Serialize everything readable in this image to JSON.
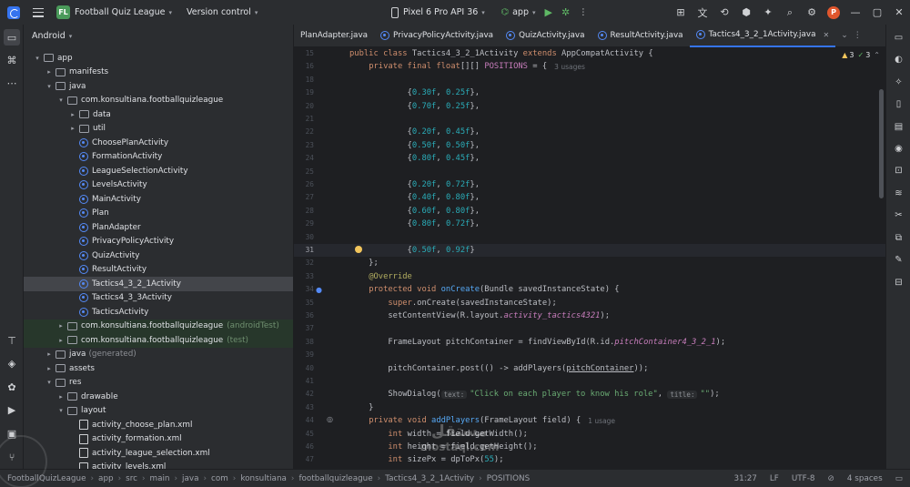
{
  "titlebar": {
    "project_initials": "FL",
    "project_name": "Football Quiz League",
    "version_control": "Version control",
    "device": "Pixel 6 Pro API 36",
    "run_config": "app",
    "avatar_initial": "P"
  },
  "project_panel": {
    "view": "Android",
    "tree": [
      {
        "label": "app",
        "indent": 0,
        "arrow": "open",
        "icon": "folder"
      },
      {
        "label": "manifests",
        "indent": 1,
        "arrow": "closed",
        "icon": "folder"
      },
      {
        "label": "java",
        "indent": 1,
        "arrow": "open",
        "icon": "folder"
      },
      {
        "label": "com.konsultiana.footballquizleague",
        "indent": 2,
        "arrow": "open",
        "icon": "package"
      },
      {
        "label": "data",
        "indent": 3,
        "arrow": "closed",
        "icon": "package"
      },
      {
        "label": "util",
        "indent": 3,
        "arrow": "closed",
        "icon": "package"
      },
      {
        "label": "ChoosePlanActivity",
        "indent": 3,
        "arrow": "",
        "icon": "class"
      },
      {
        "label": "FormationActivity",
        "indent": 3,
        "arrow": "",
        "icon": "class"
      },
      {
        "label": "LeagueSelectionActivity",
        "indent": 3,
        "arrow": "",
        "icon": "class"
      },
      {
        "label": "LevelsActivity",
        "indent": 3,
        "arrow": "",
        "icon": "class"
      },
      {
        "label": "MainActivity",
        "indent": 3,
        "arrow": "",
        "icon": "class"
      },
      {
        "label": "Plan",
        "indent": 3,
        "arrow": "",
        "icon": "class"
      },
      {
        "label": "PlanAdapter",
        "indent": 3,
        "arrow": "",
        "icon": "class"
      },
      {
        "label": "PrivacyPolicyActivity",
        "indent": 3,
        "arrow": "",
        "icon": "class"
      },
      {
        "label": "QuizActivity",
        "indent": 3,
        "arrow": "",
        "icon": "class"
      },
      {
        "label": "ResultActivity",
        "indent": 3,
        "arrow": "",
        "icon": "class"
      },
      {
        "label": "Tactics4_3_2_1Activity",
        "indent": 3,
        "arrow": "",
        "icon": "class",
        "selected": true
      },
      {
        "label": "Tactics4_3_3Activity",
        "indent": 3,
        "arrow": "",
        "icon": "class"
      },
      {
        "label": "TacticsActivity",
        "indent": 3,
        "arrow": "",
        "icon": "class"
      },
      {
        "label": "com.konsultiana.footballquizleague",
        "suffix": "(androidTest)",
        "indent": 2,
        "arrow": "closed",
        "icon": "package",
        "test": true
      },
      {
        "label": "com.konsultiana.footballquizleague",
        "suffix": "(test)",
        "indent": 2,
        "arrow": "closed",
        "icon": "package",
        "test": true
      },
      {
        "label": "java",
        "suffix": "(generated)",
        "indent": 1,
        "arrow": "closed",
        "icon": "folder"
      },
      {
        "label": "assets",
        "indent": 1,
        "arrow": "closed",
        "icon": "folder"
      },
      {
        "label": "res",
        "indent": 1,
        "arrow": "open",
        "icon": "folder"
      },
      {
        "label": "drawable",
        "indent": 2,
        "arrow": "closed",
        "icon": "folder"
      },
      {
        "label": "layout",
        "indent": 2,
        "arrow": "open",
        "icon": "folder"
      },
      {
        "label": "activity_choose_plan.xml",
        "indent": 3,
        "arrow": "",
        "icon": "xml"
      },
      {
        "label": "activity_formation.xml",
        "indent": 3,
        "arrow": "",
        "icon": "xml"
      },
      {
        "label": "activity_league_selection.xml",
        "indent": 3,
        "arrow": "",
        "icon": "xml"
      },
      {
        "label": "activity_levels.xml",
        "indent": 3,
        "arrow": "",
        "icon": "xml"
      }
    ]
  },
  "tabs": [
    {
      "label": "PlanAdapter.java",
      "active": false
    },
    {
      "label": "PrivacyPolicyActivity.java",
      "active": false
    },
    {
      "label": "QuizActivity.java",
      "active": false
    },
    {
      "label": "ResultActivity.java",
      "active": false
    },
    {
      "label": "Tactics4_3_2_1Activity.java",
      "active": true
    }
  ],
  "inspections": {
    "warnings": "3",
    "weak_warnings": "3"
  },
  "editor": {
    "line_numbers": [
      "15",
      "16",
      "18",
      "19",
      "20",
      "21",
      "22",
      "23",
      "24",
      "25",
      "26",
      "27",
      "28",
      "29",
      "30",
      "31",
      "32",
      "33",
      "34",
      "35",
      "36",
      "37",
      "38",
      "39",
      "40",
      "41",
      "42",
      "43",
      "44",
      "45",
      "46",
      "47"
    ],
    "lines": [
      [
        {
          "t": "public class ",
          "c": "kw"
        },
        {
          "t": "Tactics4_3_2_1Activity "
        },
        {
          "t": "extends ",
          "c": "kw"
        },
        {
          "t": "AppCompatActivity {"
        }
      ],
      [
        {
          "t": "    "
        },
        {
          "t": "private final float",
          "c": "kw"
        },
        {
          "t": "[][] "
        },
        {
          "t": "POSITIONS",
          "c": "fld"
        },
        {
          "t": " = {"
        },
        {
          "t": "3 usages",
          "c": "usage"
        }
      ],
      [],
      [
        {
          "t": "            {"
        },
        {
          "t": "0.30f",
          "c": "num"
        },
        {
          "t": ", "
        },
        {
          "t": "0.25f",
          "c": "num"
        },
        {
          "t": "},"
        }
      ],
      [
        {
          "t": "            {"
        },
        {
          "t": "0.70f",
          "c": "num"
        },
        {
          "t": ", "
        },
        {
          "t": "0.25f",
          "c": "num"
        },
        {
          "t": "},"
        }
      ],
      [],
      [
        {
          "t": "            {"
        },
        {
          "t": "0.20f",
          "c": "num"
        },
        {
          "t": ", "
        },
        {
          "t": "0.45f",
          "c": "num"
        },
        {
          "t": "},"
        }
      ],
      [
        {
          "t": "            {"
        },
        {
          "t": "0.50f",
          "c": "num"
        },
        {
          "t": ", "
        },
        {
          "t": "0.50f",
          "c": "num"
        },
        {
          "t": "},"
        }
      ],
      [
        {
          "t": "            {"
        },
        {
          "t": "0.80f",
          "c": "num"
        },
        {
          "t": ", "
        },
        {
          "t": "0.45f",
          "c": "num"
        },
        {
          "t": "},"
        }
      ],
      [],
      [
        {
          "t": "            {"
        },
        {
          "t": "0.20f",
          "c": "num"
        },
        {
          "t": ", "
        },
        {
          "t": "0.72f",
          "c": "num"
        },
        {
          "t": "},"
        }
      ],
      [
        {
          "t": "            {"
        },
        {
          "t": "0.40f",
          "c": "num"
        },
        {
          "t": ", "
        },
        {
          "t": "0.80f",
          "c": "num"
        },
        {
          "t": "},"
        }
      ],
      [
        {
          "t": "            {"
        },
        {
          "t": "0.60f",
          "c": "num"
        },
        {
          "t": ", "
        },
        {
          "t": "0.80f",
          "c": "num"
        },
        {
          "t": "},"
        }
      ],
      [
        {
          "t": "            {"
        },
        {
          "t": "0.80f",
          "c": "num"
        },
        {
          "t": ", "
        },
        {
          "t": "0.72f",
          "c": "num"
        },
        {
          "t": "},"
        }
      ],
      [],
      [
        {
          "t": "            {"
        },
        {
          "t": "0.50f",
          "c": "num"
        },
        {
          "t": ", "
        },
        {
          "t": "0.92f",
          "c": "num"
        },
        {
          "t": "}"
        }
      ],
      [
        {
          "t": "    };"
        }
      ],
      [
        {
          "t": "    "
        },
        {
          "t": "@Override",
          "c": "ann"
        }
      ],
      [
        {
          "t": "    "
        },
        {
          "t": "protected void ",
          "c": "kw"
        },
        {
          "t": "onCreate",
          "c": "fn"
        },
        {
          "t": "(Bundle savedInstanceState) {"
        }
      ],
      [
        {
          "t": "        "
        },
        {
          "t": "super",
          "c": "kw"
        },
        {
          "t": ".onCreate(savedInstanceState);"
        }
      ],
      [
        {
          "t": "        setContentView(R.layout."
        },
        {
          "t": "activity_tactics4321",
          "c": "fldi"
        },
        {
          "t": ");"
        }
      ],
      [],
      [
        {
          "t": "        FrameLayout pitchContainer = findViewById(R.id."
        },
        {
          "t": "pitchContainer4_3_2_1",
          "c": "fldi"
        },
        {
          "t": ");"
        }
      ],
      [],
      [
        {
          "t": "        pitchContainer.post(() -> addPlayers("
        },
        {
          "t": "pitchContainer",
          "c": "und"
        },
        {
          "t": "));"
        }
      ],
      [],
      [
        {
          "t": "        ShowDialog("
        },
        {
          "t": "text:",
          "c": "box"
        },
        {
          "t": "\"Click on each player to know his role\"",
          "c": "str"
        },
        {
          "t": ", "
        },
        {
          "t": "title:",
          "c": "box"
        },
        {
          "t": "\"\"",
          "c": "str"
        },
        {
          "t": ");"
        }
      ],
      [
        {
          "t": "    }"
        }
      ],
      [
        {
          "t": "    "
        },
        {
          "t": "private void ",
          "c": "kw"
        },
        {
          "t": "addPlayers",
          "c": "fn"
        },
        {
          "t": "(FrameLayout field) {"
        },
        {
          "t": "1 usage",
          "c": "usage"
        }
      ],
      [
        {
          "t": "        "
        },
        {
          "t": "int ",
          "c": "kw"
        },
        {
          "t": "width = field.getWidth();"
        }
      ],
      [
        {
          "t": "        "
        },
        {
          "t": "int ",
          "c": "kw"
        },
        {
          "t": "height = field.getHeight();"
        }
      ],
      [
        {
          "t": "        "
        },
        {
          "t": "int ",
          "c": "kw"
        },
        {
          "t": "sizePx = dpToPx("
        },
        {
          "t": "55",
          "c": "num"
        },
        {
          "t": ");"
        }
      ]
    ]
  },
  "statusbar": {
    "breadcrumb": [
      "FootballQuizLeague",
      "app",
      "src",
      "main",
      "java",
      "com",
      "konsultiana",
      "footballquizleague",
      "Tactics4_3_2_1Activity",
      "POSITIONS"
    ],
    "position": "31:27",
    "line_sep": "LF",
    "encoding": "UTF-8",
    "indent": "4 spaces"
  },
  "watermark": {
    "line1": "مستقل",
    "line2": "mostaql.com"
  }
}
